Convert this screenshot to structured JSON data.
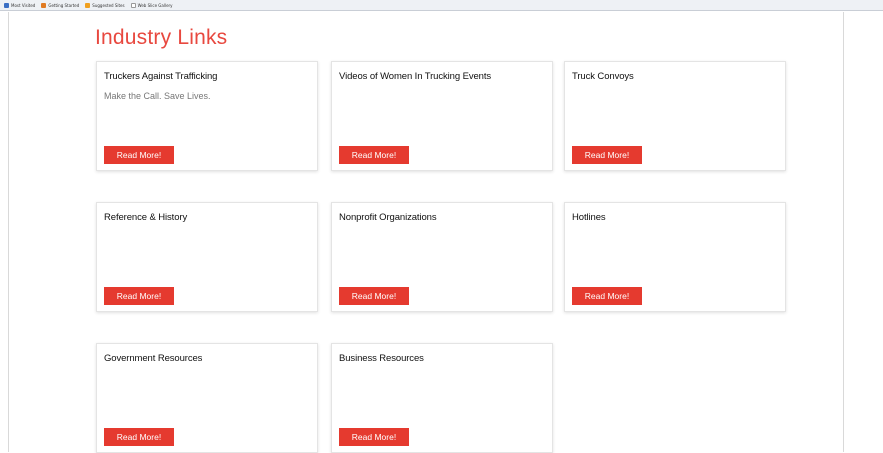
{
  "bookmarks": [
    {
      "label": "Most Visited",
      "icon": "globe-icon"
    },
    {
      "label": "Getting Started",
      "icon": "firefox-icon"
    },
    {
      "label": "Suggested Sites",
      "icon": "star-icon"
    },
    {
      "label": "Web Slice Gallery",
      "icon": "page-icon"
    }
  ],
  "page": {
    "title": "Industry Links"
  },
  "cards": [
    {
      "title": "Truckers Against Trafficking",
      "desc": "Make the Call. Save Lives.",
      "button": "Read More!"
    },
    {
      "title": "Videos of Women In Trucking Events",
      "desc": "",
      "button": "Read More!"
    },
    {
      "title": "Truck Convoys",
      "desc": "",
      "button": "Read More!"
    },
    {
      "title": "Reference & History",
      "desc": "",
      "button": "Read More!"
    },
    {
      "title": "Nonprofit Organizations",
      "desc": "",
      "button": "Read More!"
    },
    {
      "title": "Hotlines",
      "desc": "",
      "button": "Read More!"
    },
    {
      "title": "Government Resources",
      "desc": "",
      "button": "Read More!"
    },
    {
      "title": "Business Resources",
      "desc": "",
      "button": "Read More!"
    }
  ],
  "colors": {
    "accent": "#e8483f",
    "button": "#e53a2f"
  }
}
